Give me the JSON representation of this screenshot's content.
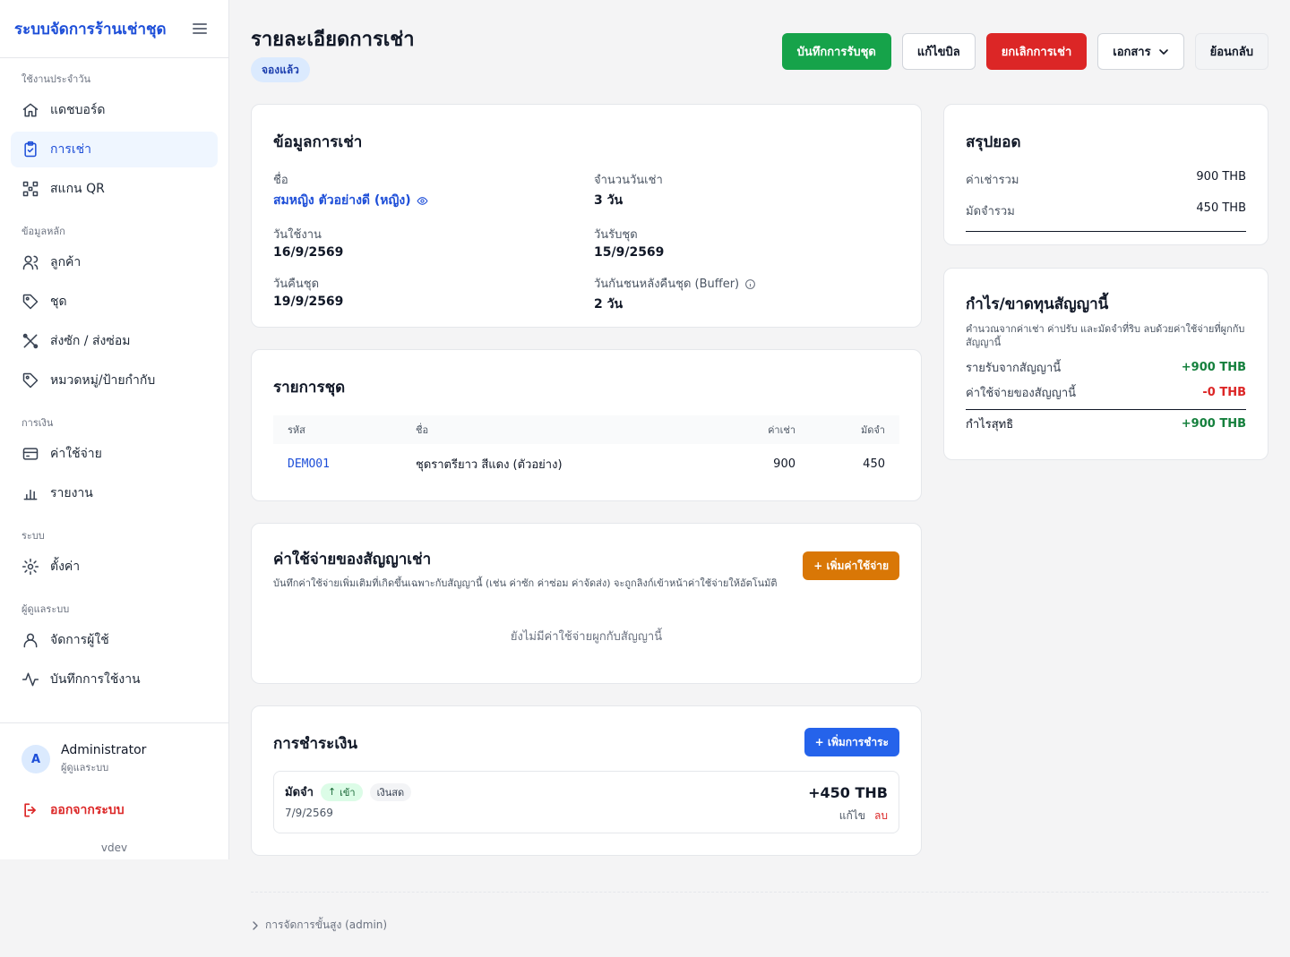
{
  "sidebar": {
    "brand": "ระบบจัดการร้านเช่าชุด",
    "sections": {
      "daily": "ใช้งานประจำวัน",
      "master": "ข้อมูลหลัก",
      "finance": "การเงิน",
      "system": "ระบบ",
      "admin": "ผู้ดูแลระบบ"
    },
    "items": {
      "dashboard": "แดชบอร์ด",
      "rentals": "การเช่า",
      "scan": "สแกน QR",
      "customers": "ลูกค้า",
      "outfits": "ชุด",
      "laundry": "ส่งซัก / ส่งซ่อม",
      "tags": "หมวดหมู่/ป้ายกำกับ",
      "expenses": "ค่าใช้จ่าย",
      "reports": "รายงาน",
      "settings": "ตั้งค่า",
      "users": "จัดการผู้ใช้",
      "logs": "บันทึกการใช้งาน"
    },
    "user": {
      "initial": "A",
      "name": "Administrator",
      "role": "ผู้ดูแลระบบ"
    },
    "logout": "ออกจากระบบ",
    "version": "vdev"
  },
  "header": {
    "title": "รายละเอียดการเช่า",
    "status": "จองแล้ว",
    "actions": {
      "pickup": "บันทึกการรับชุด",
      "edit_bill": "แก้ไขบิล",
      "cancel": "ยกเลิกการเช่า",
      "documents": "เอกสาร",
      "back": "ย้อนกลับ"
    }
  },
  "rental_info": {
    "title": "ข้อมูลการเช่า",
    "name_label": "ชื่อ",
    "name_value": "สมหญิง ตัวอย่างดี (หญิง)",
    "days_label": "จำนวนวันเช่า",
    "days_value": "3 วัน",
    "use_date_label": "วันใช้งาน",
    "use_date_value": "16/9/2569",
    "pickup_date_label": "วันรับชุด",
    "pickup_date_value": "15/9/2569",
    "return_date_label": "วันคืนชุด",
    "return_date_value": "19/9/2569",
    "buffer_label": "วันกันชนหลังคืนชุด (Buffer)",
    "buffer_value": "2 วัน"
  },
  "items": {
    "title": "รายการชุด",
    "headers": {
      "code": "รหัส",
      "name": "ชื่อ",
      "rent": "ค่าเช่า",
      "deposit": "มัดจำ"
    },
    "rows": [
      {
        "code": "DEMO01",
        "name": "ชุดราตรียาว สีแดง (ตัวอย่าง)",
        "rent": "900",
        "deposit": "450"
      }
    ]
  },
  "expenses": {
    "title": "ค่าใช้จ่ายของสัญญาเช่า",
    "subtitle": "บันทึกค่าใช้จ่ายเพิ่มเติมที่เกิดขึ้นเฉพาะกับสัญญานี้ (เช่น ค่าซัก ค่าซ่อม ค่าจัดส่ง) จะถูกลิงก์เข้าหน้าค่าใช้จ่ายให้อัตโนมัติ",
    "add_button": "+ เพิ่มค่าใช้จ่าย",
    "empty": "ยังไม่มีค่าใช้จ่ายผูกกับสัญญานี้"
  },
  "payments": {
    "title": "การชำระเงิน",
    "add_button": "+ เพิ่มการชำระ",
    "rows": [
      {
        "type": "มัดจำ",
        "direction": "เข้า",
        "method": "เงินสด",
        "date": "7/9/2569",
        "amount": "+450 THB",
        "edit": "แก้ไข",
        "delete": "ลบ"
      }
    ]
  },
  "summary": {
    "title": "สรุปยอด",
    "rent_total_label": "ค่าเช่ารวม",
    "rent_total_value": "900 THB",
    "deposit_total_label": "มัดจำรวม",
    "deposit_total_value": "450 THB"
  },
  "profit": {
    "title": "กำไร/ขาดทุนสัญญานี้",
    "subtitle": "คำนวณจากค่าเช่า ค่าปรับ และมัดจำที่ริบ ลบด้วยค่าใช้จ่ายที่ผูกกับสัญญานี้",
    "income_label": "รายรับจากสัญญานี้",
    "income_value": "+900 THB",
    "expense_label": "ค่าใช้จ่ายของสัญญานี้",
    "expense_value": "-0 THB",
    "net_label": "กำไรสุทธิ",
    "net_value": "+900 THB"
  },
  "footer": {
    "admin_link": "การจัดการขั้นสูง (admin)"
  },
  "colors": {
    "primary": "#1d4ed8",
    "success": "#16a34a",
    "danger": "#dc2626",
    "warning": "#d97706",
    "badge_bg": "#dbeafe"
  }
}
